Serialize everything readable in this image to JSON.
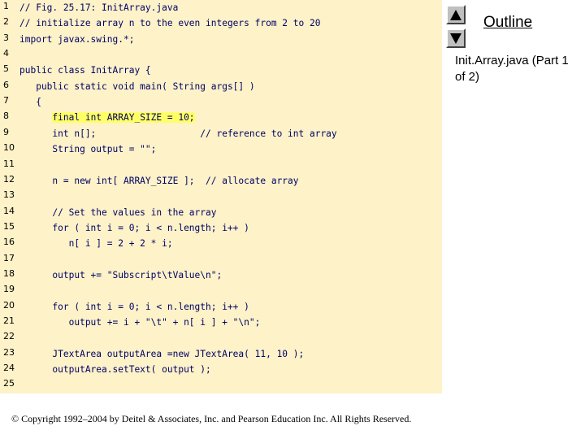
{
  "navigation": {
    "up_icon": "triangle-up-icon",
    "down_icon": "triangle-down-icon",
    "outline_label": "Outline"
  },
  "side_caption": "Init.Array.java (Part 1 of 2)",
  "copyright": "© Copyright 1992–2004 by Deitel & Associates, Inc. and Pearson Education Inc. All Rights Reserved.",
  "colors": {
    "code_background": "#fdf2c8",
    "highlight": "#ffff66"
  },
  "code_lines": [
    {
      "n": "1",
      "text": "// Fig. 25.17: InitArray.java"
    },
    {
      "n": "2",
      "text": "// initialize array n to the even integers from 2 to 20"
    },
    {
      "n": "3",
      "text": "import javax.swing.*;"
    },
    {
      "n": "4",
      "text": ""
    },
    {
      "n": "5",
      "text": "public class InitArray {"
    },
    {
      "n": "6",
      "text": "   public static void main( String args[] )"
    },
    {
      "n": "7",
      "text": "   {"
    },
    {
      "n": "8",
      "text": "      final int ARRAY_SIZE = 10;",
      "highlight": true
    },
    {
      "n": "9",
      "text": "      int n[];                   // reference to int array"
    },
    {
      "n": "10",
      "text": "      String output = \"\";"
    },
    {
      "n": "11",
      "text": ""
    },
    {
      "n": "12",
      "text": "      n = new int[ ARRAY_SIZE ];  // allocate array"
    },
    {
      "n": "13",
      "text": ""
    },
    {
      "n": "14",
      "text": "      // Set the values in the array"
    },
    {
      "n": "15",
      "text": "      for ( int i = 0; i < n.length; i++ )"
    },
    {
      "n": "16",
      "text": "         n[ i ] = 2 + 2 * i;"
    },
    {
      "n": "17",
      "text": ""
    },
    {
      "n": "18",
      "text": "      output += \"Subscript\\tValue\\n\";"
    },
    {
      "n": "19",
      "text": ""
    },
    {
      "n": "20",
      "text": "      for ( int i = 0; i < n.length; i++ )"
    },
    {
      "n": "21",
      "text": "         output += i + \"\\t\" + n[ i ] + \"\\n\";"
    },
    {
      "n": "22",
      "text": ""
    },
    {
      "n": "23",
      "text": "      JTextArea outputArea =new JTextArea( 11, 10 );"
    },
    {
      "n": "24",
      "text": "      outputArea.setText( output );"
    },
    {
      "n": "25",
      "text": ""
    }
  ]
}
